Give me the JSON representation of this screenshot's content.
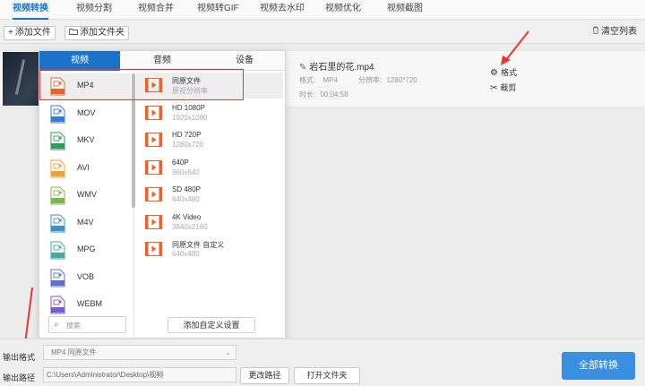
{
  "tabs": [
    {
      "label": "视频转换",
      "active": true
    },
    {
      "label": "视频分割"
    },
    {
      "label": "视频合并"
    },
    {
      "label": "视频转GIF"
    },
    {
      "label": "视频去水印"
    },
    {
      "label": "视频优化"
    },
    {
      "label": "视频截图"
    }
  ],
  "toolbar": {
    "add_file": "添加文件",
    "add_folder": "添加文件夹",
    "clear_list": "清空列表"
  },
  "file": {
    "name": "岩石里的花.mp4",
    "format_label": "格式:",
    "format_value": "MP4",
    "resolution_label": "分辨率:",
    "resolution_value": "1280*720",
    "duration_label": "时长:",
    "duration_value": "00:04:58",
    "format_button": "格式",
    "cut_button": "裁剪"
  },
  "panel": {
    "tabs": [
      "视频",
      "音频",
      "设备"
    ],
    "formats": [
      "MP4",
      "MOV",
      "MKV",
      "AVI",
      "WMV",
      "M4V",
      "MPG",
      "VOB",
      "WEBM"
    ],
    "search_placeholder": "搜索",
    "resolutions": [
      {
        "title": "同原文件",
        "sub": "原视分辨率"
      },
      {
        "title": "HD 1080P",
        "sub": "1920x1080"
      },
      {
        "title": "HD 720P",
        "sub": "1280x720"
      },
      {
        "title": "640P",
        "sub": "960x640"
      },
      {
        "title": "SD 480P",
        "sub": "640x480"
      },
      {
        "title": "4K Video",
        "sub": "3840x2160"
      },
      {
        "title": "同原文件 自定义",
        "sub": "640x480"
      }
    ],
    "add_custom": "添加自定义设置"
  },
  "bottom": {
    "output_format_label": "输出格式",
    "output_format_value": "MP4  同原文件",
    "output_path_label": "输出路径",
    "output_path_value": "C:\\Users\\Administrator\\Desktop\\视频",
    "change_path": "更改路径",
    "open_folder": "打开文件夹",
    "convert_all": "全部转换"
  },
  "colors": {
    "accent": "#1a73c9",
    "convert_button": "#3a8fe0",
    "highlight_box": "#e33333",
    "icon_orange": "#e8642c"
  }
}
